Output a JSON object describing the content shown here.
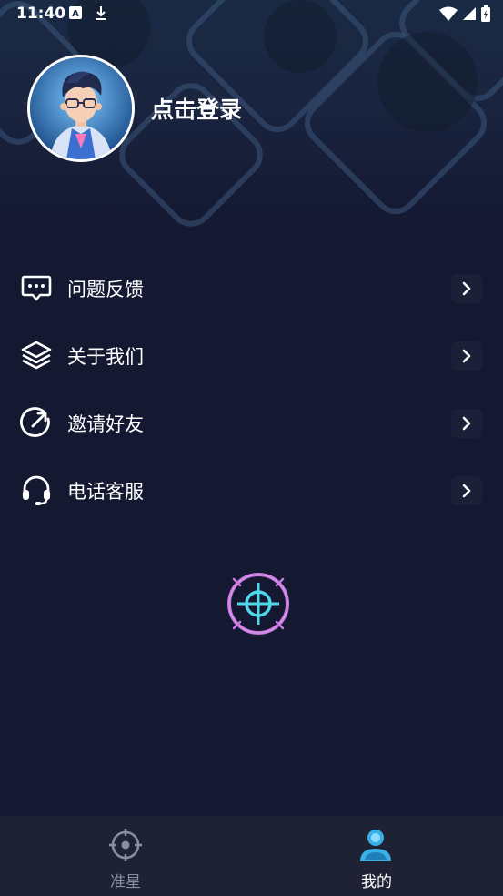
{
  "status_bar": {
    "time": "11:40",
    "left_icons": [
      "font-download-icon",
      "download-icon"
    ],
    "right_icons": [
      "wifi-icon",
      "signal-icon",
      "battery-icon"
    ]
  },
  "profile": {
    "avatar_icon": "avatar-illustration",
    "login_text": "点击登录"
  },
  "menu": {
    "items": [
      {
        "label": "问题反馈",
        "icon": "feedback-chat-icon"
      },
      {
        "label": "关于我们",
        "icon": "layers-icon"
      },
      {
        "label": "邀请好友",
        "icon": "share-arrow-icon"
      },
      {
        "label": "电话客服",
        "icon": "headset-icon"
      }
    ],
    "chevron_icon": "chevron-right-icon"
  },
  "center_logo": {
    "icon": "crosshair-logo-icon"
  },
  "tabbar": {
    "tabs": [
      {
        "label": "准星",
        "icon": "crosshair-tab-icon",
        "active": false
      },
      {
        "label": "我的",
        "icon": "user-tab-icon",
        "active": true
      }
    ]
  },
  "colors": {
    "background": "#141830",
    "tabbar_bg": "#1f2135",
    "accent": "#3ab0e8",
    "inactive_tab": "#8a8f9e",
    "logo_ring": "#c97be0",
    "logo_cross": "#4fd8e8"
  }
}
